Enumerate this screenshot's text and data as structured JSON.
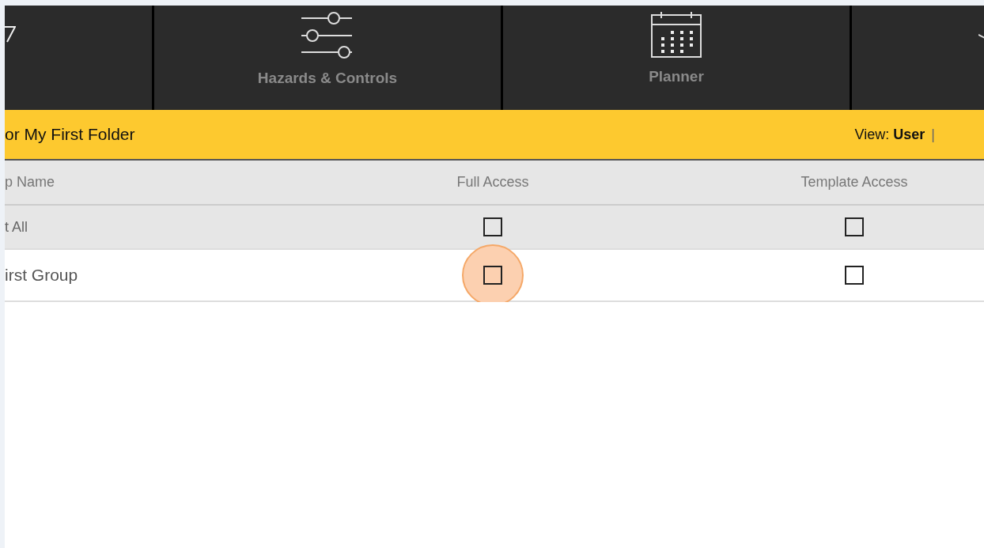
{
  "nav_tabs": [
    {
      "kind": "funnel"
    },
    {
      "kind": "sliders",
      "label": "Hazards & Controls"
    },
    {
      "kind": "calendar",
      "label": "Planner"
    },
    {
      "kind": "partial"
    }
  ],
  "folder_bar": {
    "title": "or My First Folder",
    "view_label": "View:",
    "view_value": "User",
    "separator": "|"
  },
  "table": {
    "columns": [
      "p Name",
      "Full Access",
      "Template Access"
    ],
    "rows": [
      {
        "kind": "select_all",
        "name": "t All",
        "full_access": {
          "checked": false
        },
        "template_access": {
          "checked": false
        }
      },
      {
        "kind": "group",
        "name": "irst Group",
        "full_access": {
          "checked": false,
          "highlighted": true
        },
        "template_access": {
          "checked": false
        }
      }
    ]
  }
}
